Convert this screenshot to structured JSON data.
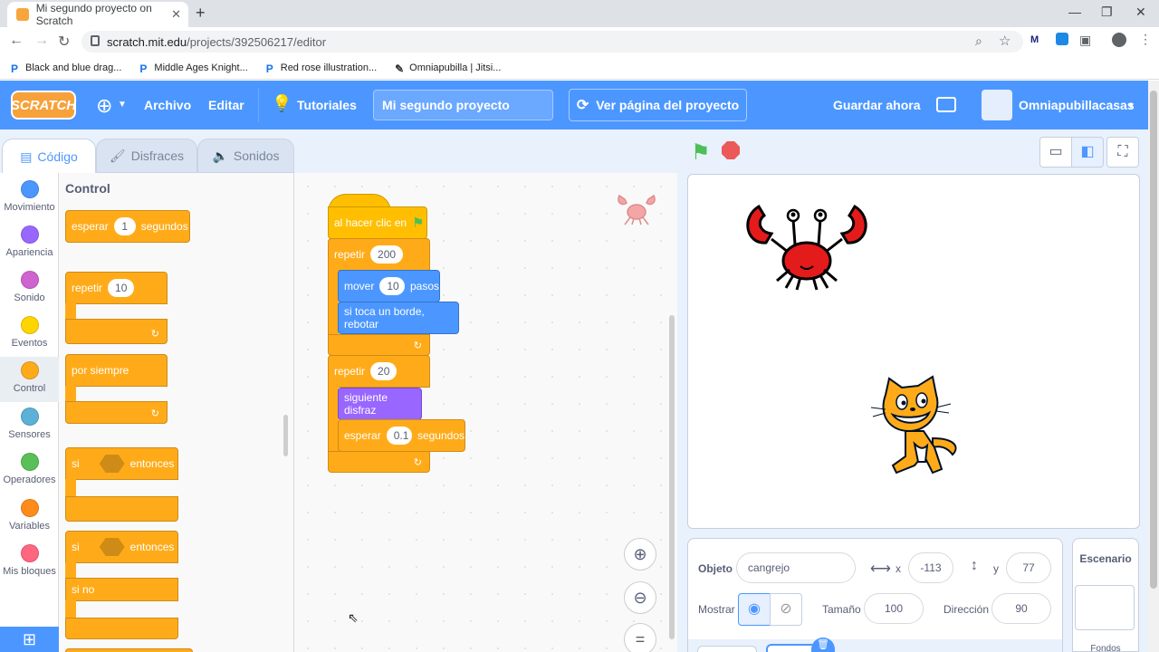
{
  "browser": {
    "tab_title": "Mi segundo proyecto on Scratch",
    "url_host": "scratch.mit.edu",
    "url_path": "/projects/392506217/editor",
    "bookmarks": [
      {
        "label": "Black and blue drag..."
      },
      {
        "label": "Middle Ages Knight..."
      },
      {
        "label": "Red rose illustration..."
      },
      {
        "label": "Omniapubilla | Jitsi..."
      }
    ]
  },
  "menubar": {
    "logo": "SCRATCH",
    "file": "Archivo",
    "edit": "Editar",
    "tutorials": "Tutoriales",
    "project_title": "Mi segundo proyecto",
    "see_project_page": "Ver página del proyecto",
    "save_now": "Guardar ahora",
    "username": "Omniapubillacasas"
  },
  "editor_tabs": {
    "code": "Código",
    "costumes": "Disfraces",
    "sounds": "Sonidos"
  },
  "categories": [
    {
      "label": "Movimiento",
      "color": "#4c97ff"
    },
    {
      "label": "Apariencia",
      "color": "#9966ff"
    },
    {
      "label": "Sonido",
      "color": "#cf63cf"
    },
    {
      "label": "Eventos",
      "color": "#ffd500"
    },
    {
      "label": "Control",
      "color": "#ffab19"
    },
    {
      "label": "Sensores",
      "color": "#5cb1d6"
    },
    {
      "label": "Operadores",
      "color": "#59c059"
    },
    {
      "label": "Variables",
      "color": "#ff8c1a"
    },
    {
      "label": "Mis bloques",
      "color": "#ff6680"
    }
  ],
  "palette": {
    "heading": "Control",
    "wait_pre": "esperar",
    "wait_val": "1",
    "wait_post": "segundos",
    "repeat_label": "repetir",
    "repeat_val": "10",
    "forever_label": "por siempre",
    "if_label": "si",
    "then_label": "entonces",
    "if2_label": "si",
    "then2_label": "entonces",
    "else_label": "si no"
  },
  "script": {
    "hat": "al hacer clic en",
    "repeat1": "repetir",
    "repeat1_val": "200",
    "move": "mover",
    "move_val": "10",
    "move_post": "pasos",
    "bounce": "si toca un borde, rebotar",
    "repeat2": "repetir",
    "repeat2_val": "20",
    "next_costume": "siguiente disfraz",
    "wait": "esperar",
    "wait_val": "0.1",
    "wait_post": "segundos"
  },
  "sprite_info": {
    "sprite_label": "Objeto",
    "sprite_name": "cangrejo",
    "x_label": "x",
    "x_val": "-113",
    "y_label": "y",
    "y_val": "77",
    "show_label": "Mostrar",
    "size_label": "Tamaño",
    "size_val": "100",
    "direction_label": "Dirección",
    "direction_val": "90"
  },
  "stage_panel": {
    "title": "Escenario",
    "backdrops": "Fondos"
  }
}
